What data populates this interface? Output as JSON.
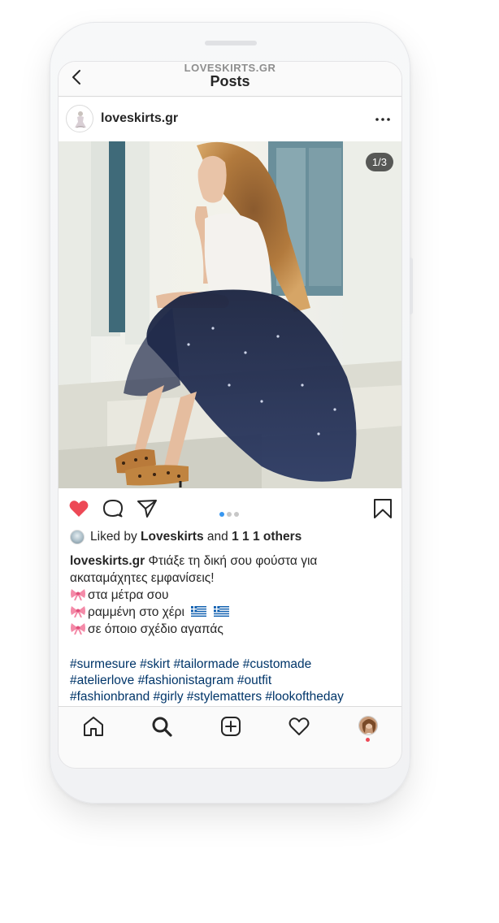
{
  "header": {
    "username_small": "LOVESKIRTS.GR",
    "title": "Posts"
  },
  "post": {
    "username": "loveskirts.gr",
    "photo_counter": "1/3",
    "carousel": {
      "count": 3,
      "active": 1
    },
    "likes": {
      "prefix": "Liked by",
      "liker": "Loveskirts",
      "and": "and",
      "others": "1 1 1 others"
    },
    "caption": {
      "username": "loveskirts.gr",
      "line1": "Φτιάξε τη δική σου φούστα για",
      "line2": "ακαταμάχητες εμφανίσεις!",
      "line3": "στα μέτρα σου",
      "line4": "ραμμένη στο χέρι",
      "line5": "σε όποιο σχέδιο αγαπάς"
    },
    "hashtags": {
      "line1": "#surmesure #skirt #tailormade #customade",
      "line2": "#atelierlove #fashionistagram #outfit",
      "line3": "#fashionbrand #girly #stylematters  #lookoftheday"
    }
  },
  "icons": {
    "back": "chevron-left-icon",
    "more": "more-horizontal-icon",
    "like": "heart-filled-icon",
    "comment": "comment-icon",
    "share": "paper-plane-icon",
    "save": "bookmark-icon",
    "bow": "ribbon-bow-emoji",
    "flag": "greek-flag-emoji",
    "tabs": [
      "home-icon",
      "search-icon",
      "add-post-icon",
      "activity-heart-icon",
      "profile-avatar"
    ]
  },
  "colors": {
    "like_red": "#ed4956",
    "hashtag_blue": "#003569",
    "carousel_active": "#3897f0"
  }
}
